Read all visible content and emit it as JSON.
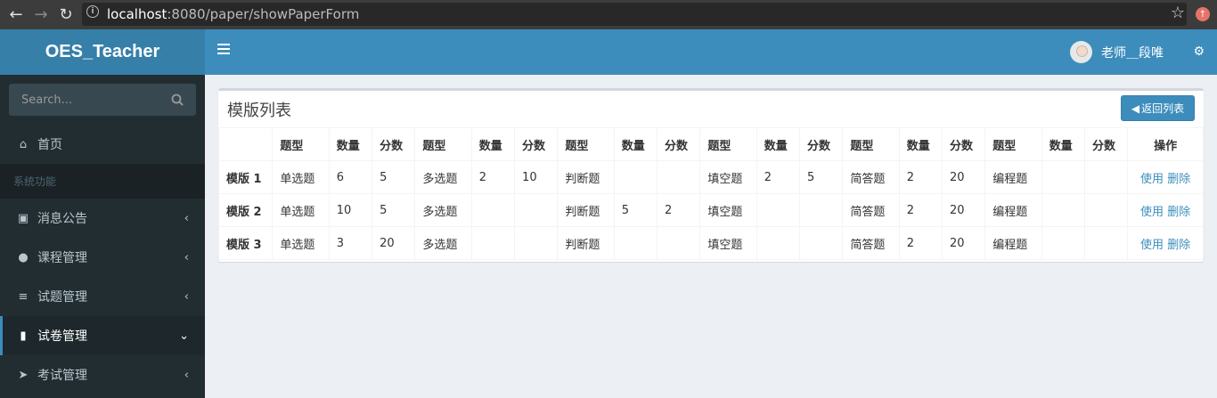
{
  "browser": {
    "url_host": "localhost",
    "url_rest": ":8080/paper/showPaperForm"
  },
  "sidebar": {
    "logo": "OES_Teacher",
    "search_placeholder": "Search...",
    "home_label": "首页",
    "section_header": "系统功能",
    "items": [
      {
        "label": "消息公告",
        "icon": "contact-card-icon"
      },
      {
        "label": "课程管理",
        "icon": "users-icon"
      },
      {
        "label": "试题管理",
        "icon": "list-icon"
      },
      {
        "label": "试卷管理",
        "icon": "book-icon"
      },
      {
        "label": "考试管理",
        "icon": "paper-plane-icon"
      }
    ]
  },
  "header": {
    "user_name": "老师＿段唯"
  },
  "box": {
    "title": "模版列表",
    "back_button": "返回列表"
  },
  "table": {
    "headers": [
      "",
      "题型",
      "数量",
      "分数",
      "题型",
      "数量",
      "分数",
      "题型",
      "数量",
      "分数",
      "题型",
      "数量",
      "分数",
      "题型",
      "数量",
      "分数",
      "题型",
      "数量",
      "分数",
      "操作"
    ],
    "rows": [
      {
        "name": "模版 1",
        "cells": [
          "单选题",
          "6",
          "5",
          "多选题",
          "2",
          "10",
          "判断题",
          "",
          "",
          "填空题",
          "2",
          "5",
          "简答题",
          "2",
          "20",
          "编程题",
          "",
          ""
        ],
        "use": "使用",
        "del": "删除"
      },
      {
        "name": "模版 2",
        "cells": [
          "单选题",
          "10",
          "5",
          "多选题",
          "",
          "",
          "判断题",
          "5",
          "2",
          "填空题",
          "",
          "",
          "简答题",
          "2",
          "20",
          "编程题",
          "",
          ""
        ],
        "use": "使用",
        "del": "删除"
      },
      {
        "name": "模版 3",
        "cells": [
          "单选题",
          "3",
          "20",
          "多选题",
          "",
          "",
          "判断题",
          "",
          "",
          "填空题",
          "",
          "",
          "简答题",
          "2",
          "20",
          "编程题",
          "",
          ""
        ],
        "use": "使用",
        "del": "删除"
      }
    ]
  },
  "colors": {
    "header_blue": "#3c8dbc",
    "logo_blue": "#367fa9",
    "sidebar_dark": "#222d32",
    "link_blue": "#3c8dbc"
  }
}
